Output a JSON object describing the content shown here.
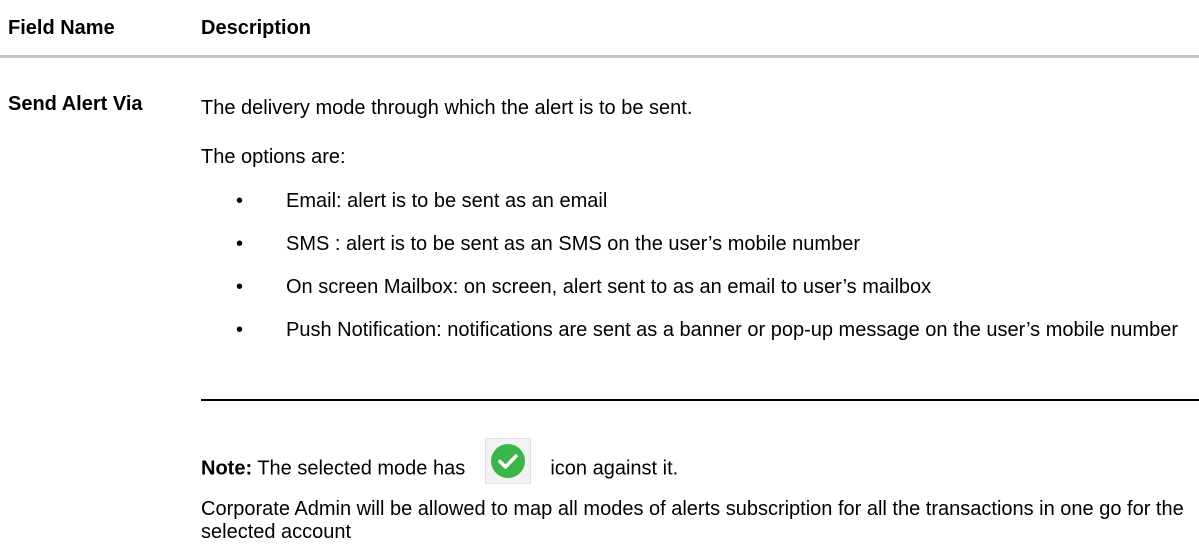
{
  "header": {
    "field_name": "Field Name",
    "description": "Description"
  },
  "row": {
    "field_name": "Send Alert Via",
    "intro": "The delivery mode through which the alert is to be sent.",
    "options_label": "The options are:",
    "bullet_glyph": "•",
    "options": [
      "Email: alert is to be sent as an email",
      "SMS : alert is to be sent as an SMS on the user’s mobile number",
      "On screen Mailbox: on screen, alert sent to as an email to user’s mailbox",
      "Push Notification: notifications are sent as a banner or pop-up message on the user’s mobile number"
    ],
    "note": {
      "label": "Note:",
      "text_before": "The selected mode has",
      "icon": "check-circle-icon",
      "icon_color": "#3ab54a",
      "text_after": "icon against it."
    },
    "corporate_text": "Corporate Admin will be allowed to map all modes of alerts subscription for all the transactions in one go for the selected account"
  }
}
